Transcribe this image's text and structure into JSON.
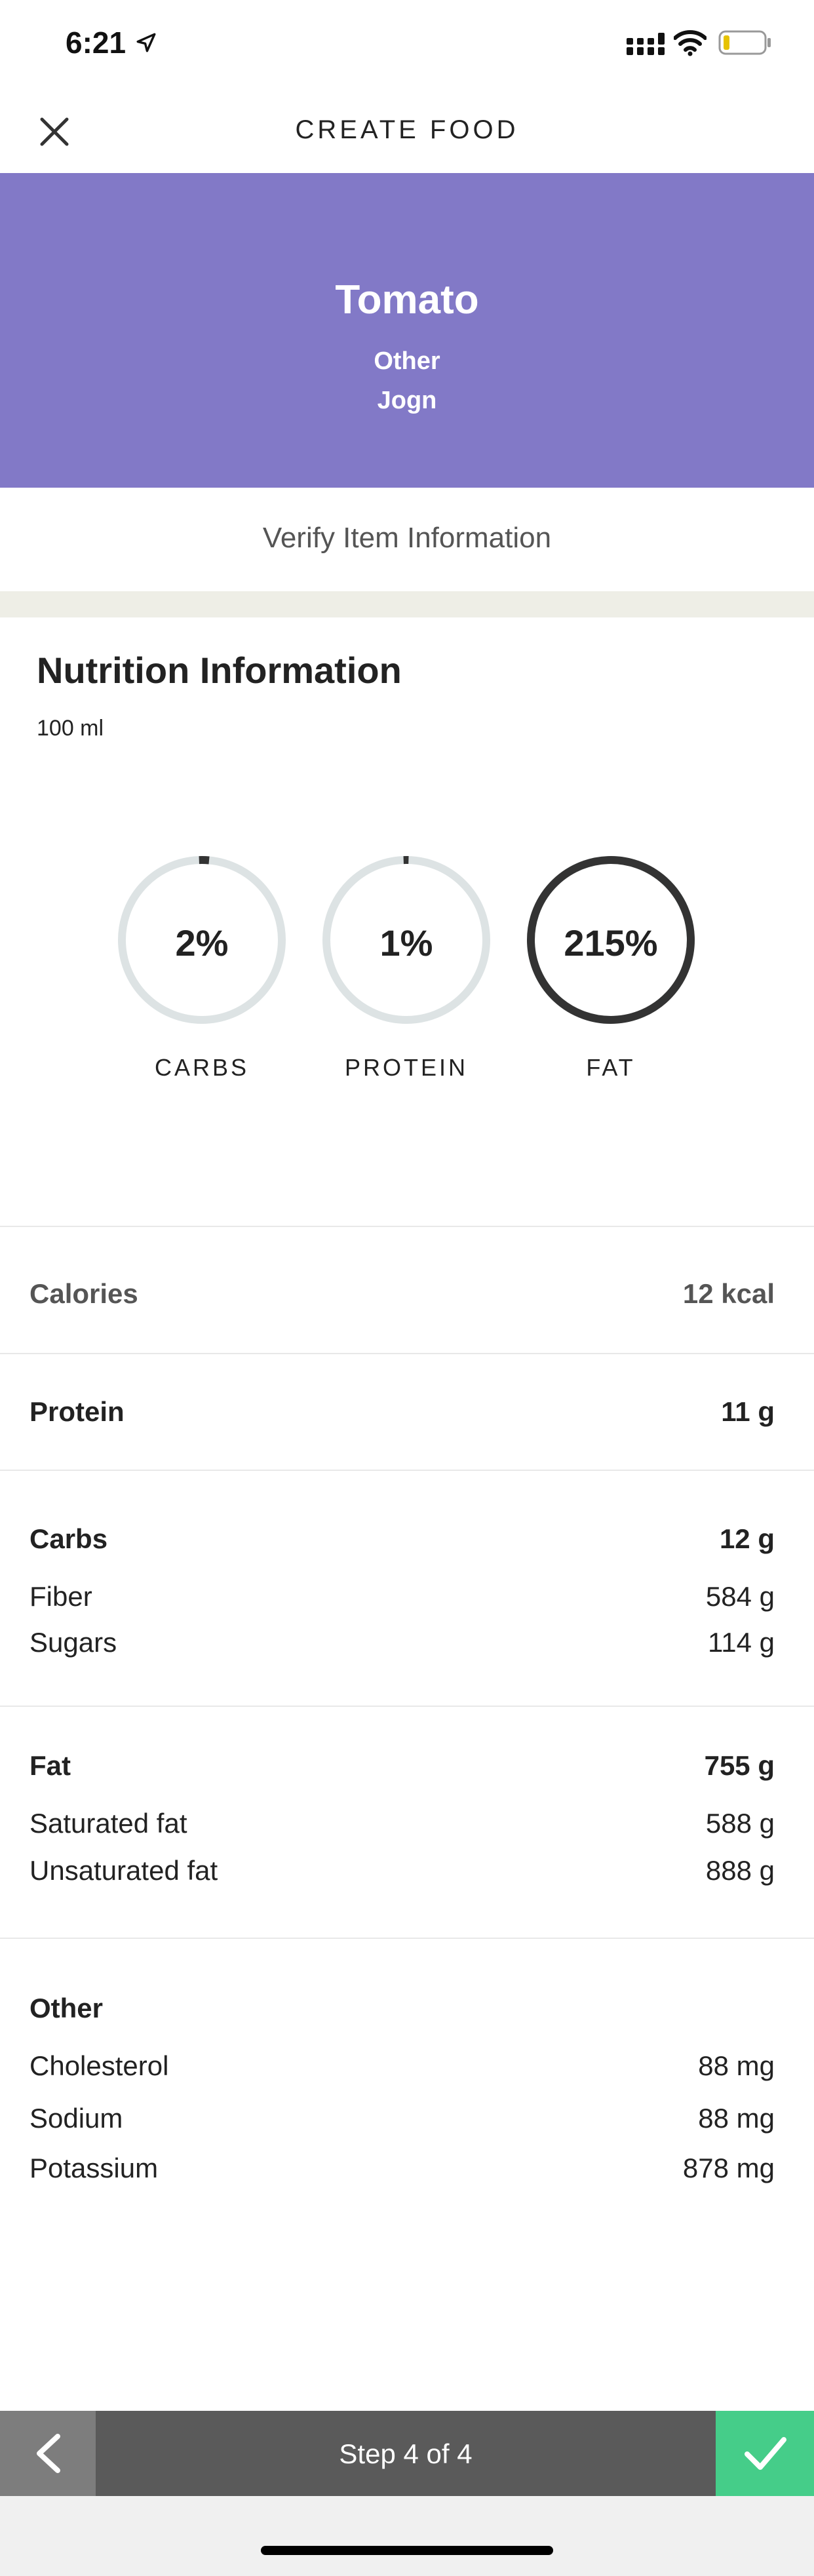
{
  "status_bar": {
    "time": "6:21",
    "icons": [
      "location-arrow-icon",
      "cellular-signal-icon",
      "wifi-icon",
      "battery-low-icon"
    ],
    "battery_level_fraction": 0.15
  },
  "header": {
    "title": "CREATE FOOD",
    "close_icon": "close-icon"
  },
  "hero": {
    "background_color": "#8279c7",
    "food_name": "Tomato",
    "category": "Other",
    "brand": "Jogn"
  },
  "verify": {
    "label": "Verify Item Information"
  },
  "nutrition": {
    "title": "Nutrition Information",
    "serving": "100 ml",
    "macros": [
      {
        "label": "CARBS",
        "percent_text": "2%",
        "percent": 2
      },
      {
        "label": "PROTEIN",
        "percent_text": "1%",
        "percent": 1
      },
      {
        "label": "FAT",
        "percent_text": "215%",
        "percent": 215
      }
    ],
    "calories": {
      "label": "Calories",
      "value": "12 kcal"
    },
    "protein": {
      "label": "Protein",
      "value": "11 g"
    },
    "carbs": {
      "label": "Carbs",
      "value": "12 g",
      "fiber": {
        "label": "Fiber",
        "value": "584 g"
      },
      "sugars": {
        "label": "Sugars",
        "value": "114 g"
      }
    },
    "fat": {
      "label": "Fat",
      "value": "755 g",
      "saturated": {
        "label": "Saturated fat",
        "value": "588 g"
      },
      "unsaturated": {
        "label": "Unsaturated fat",
        "value": "888 g"
      }
    },
    "other": {
      "label": "Other",
      "cholesterol": {
        "label": "Cholesterol",
        "value": "88 mg"
      },
      "sodium": {
        "label": "Sodium",
        "value": "88 mg"
      },
      "potassium": {
        "label": "Potassium",
        "value": "878 mg"
      }
    }
  },
  "footer": {
    "step_label": "Step 4 of 4",
    "back_icon": "chevron-left-icon",
    "confirm_icon": "checkmark-icon",
    "confirm_color": "#45cd89"
  }
}
